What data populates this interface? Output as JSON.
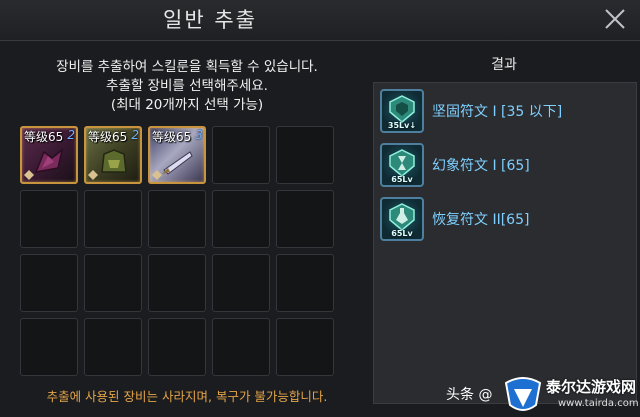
{
  "window": {
    "title": "일반 추출"
  },
  "instructions": {
    "line1": "장비를 추출하여 스킬룬을 획득할 수 있습니다.",
    "line2": "추출할 장비를 선택해주세요.",
    "line3": "(최대 20개까지 선택 가능)"
  },
  "equipment_slots": [
    {
      "level_label": "等级65",
      "enhance": "2"
    },
    {
      "level_label": "等级65",
      "enhance": "2"
    },
    {
      "level_label": "等级65",
      "enhance": "3"
    }
  ],
  "grid": {
    "columns": 5,
    "rows": 4,
    "total_slots": 20,
    "filled": 3
  },
  "warning": "추출에 사용된 장비는 사라지며, 복구가 불가능합니다.",
  "results": {
    "title": "결과",
    "items": [
      {
        "name": "坚固符文 I [35 以下]",
        "badge": "35Lv↓",
        "icon": "rune-shield-icon"
      },
      {
        "name": "幻象符文 I [65]",
        "badge": "65Lv",
        "icon": "rune-hourglass-icon"
      },
      {
        "name": "恢复符文 II[65]",
        "badge": "65Lv",
        "icon": "rune-potion-icon"
      }
    ]
  },
  "watermark": {
    "text": "头条 @",
    "logo_main": "泰尔达游戏网",
    "logo_sub": "www.tairda.com"
  },
  "colors": {
    "accent_gold": "#c8953e",
    "result_text": "#7fd0ff",
    "warning_text": "#e2a348"
  }
}
